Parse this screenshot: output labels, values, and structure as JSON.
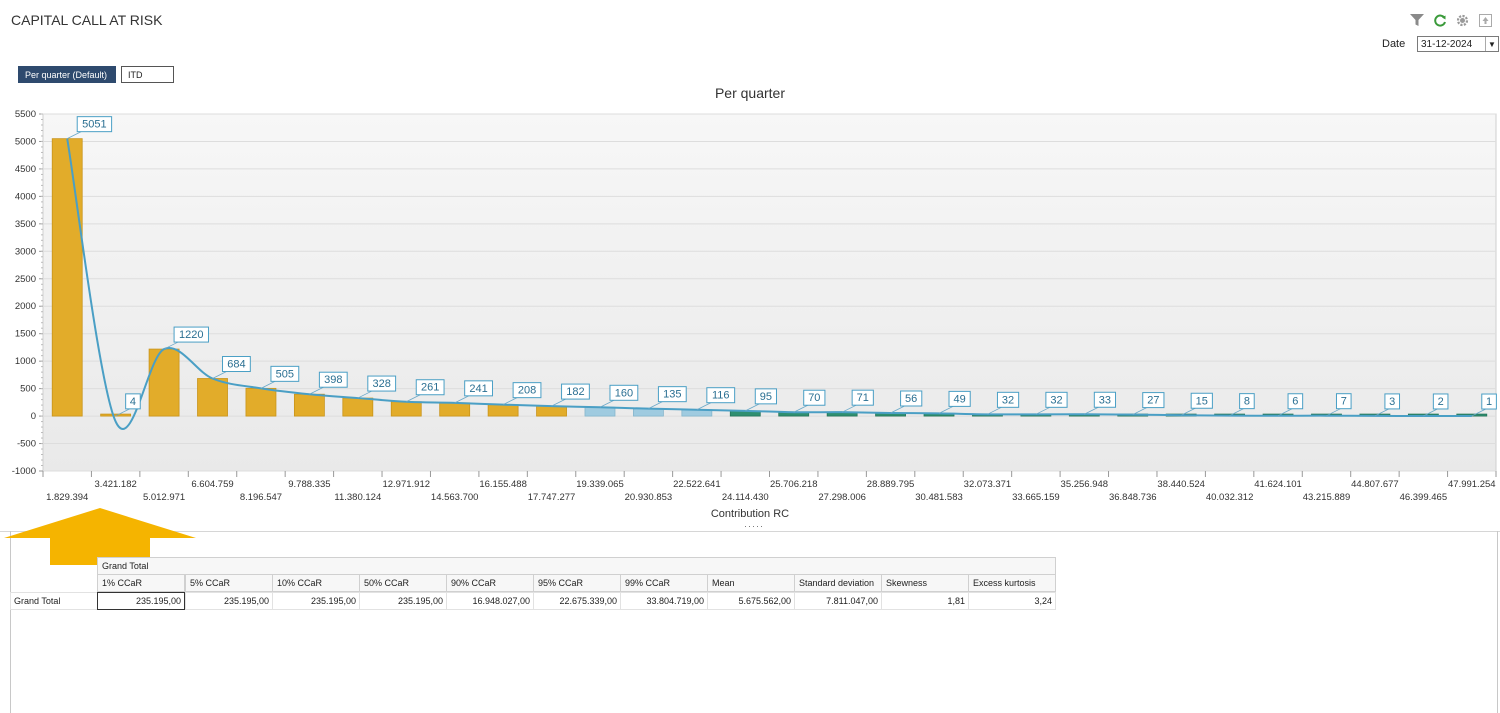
{
  "header": {
    "title": "CAPITAL CALL AT RISK"
  },
  "toolbar": {
    "icons": [
      "filter-icon",
      "refresh-icon",
      "settings-icon",
      "export-icon"
    ]
  },
  "date": {
    "label": "Date",
    "value": "31-12-2024"
  },
  "tabs": [
    {
      "label": "Per quarter (Default)",
      "active": true
    },
    {
      "label": "ITD",
      "active": false
    }
  ],
  "colors": {
    "gold": "#e2ac2a",
    "light_blue": "#9fcbe0",
    "teal": "#2f8f70",
    "line": "#4a9fc5",
    "nav": "#2e4a6e",
    "arrow": "#f5b400"
  },
  "chart_data": {
    "type": "bar",
    "title": "Per quarter",
    "xlabel": "Contribution RC",
    "ylabel": "",
    "ylim": [
      -1000,
      5500
    ],
    "yticks": [
      5500,
      5000,
      4500,
      4000,
      3500,
      3000,
      2500,
      2000,
      1500,
      1000,
      500,
      0,
      -500,
      -1000
    ],
    "grid": true,
    "categories": [
      "1.829.394",
      "3.421.182",
      "5.012.971",
      "6.604.759",
      "8.196.547",
      "9.788.335",
      "11.380.124",
      "12.971.912",
      "14.563.700",
      "16.155.488",
      "17.747.277",
      "19.339.065",
      "20.930.853",
      "22.522.641",
      "24.114.430",
      "25.706.218",
      "27.298.006",
      "28.889.795",
      "30.481.583",
      "32.073.371",
      "33.665.159",
      "35.256.948",
      "36.848.736",
      "38.440.524",
      "40.032.312",
      "41.624.101",
      "43.215.889",
      "44.807.677",
      "46.399.465",
      "47.991.254"
    ],
    "values": [
      5051,
      4,
      1220,
      684,
      505,
      398,
      328,
      261,
      241,
      208,
      182,
      160,
      135,
      116,
      95,
      70,
      71,
      56,
      49,
      32,
      32,
      33,
      27,
      15,
      8,
      6,
      7,
      3,
      2,
      1
    ],
    "bar_groups": [
      "gold",
      "gold",
      "gold",
      "gold",
      "gold",
      "gold",
      "gold",
      "gold",
      "gold",
      "gold",
      "gold",
      "light_blue",
      "light_blue",
      "light_blue",
      "teal",
      "teal",
      "teal",
      "teal",
      "teal",
      "teal",
      "teal",
      "teal",
      "teal",
      "teal",
      "teal",
      "teal",
      "teal",
      "teal",
      "teal",
      "teal"
    ],
    "fit_line": true
  },
  "table": {
    "column_group": "Grand Total",
    "columns": [
      "1% CCaR",
      "5% CCaR",
      "10% CCaR",
      "50% CCaR",
      "90% CCaR",
      "95% CCaR",
      "99% CCaR",
      "Mean",
      "Standard deviation",
      "Skewness",
      "Excess kurtosis"
    ],
    "rows": [
      {
        "label": "Grand Total",
        "values": [
          "235.195,00",
          "235.195,00",
          "235.195,00",
          "235.195,00",
          "16.948.027,00",
          "22.675.339,00",
          "33.804.719,00",
          "5.675.562,00",
          "7.811.047,00",
          "1,81",
          "3,24"
        ]
      }
    ]
  }
}
